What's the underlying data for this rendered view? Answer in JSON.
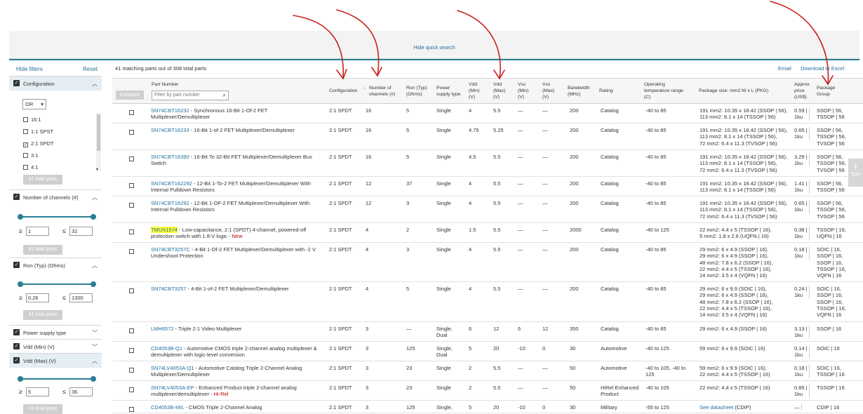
{
  "quick_search": {
    "hide_label": "Hide quick search"
  },
  "sidebar": {
    "hide_filters": "Hide filters",
    "reset": "Reset",
    "configuration": {
      "title": "Configuration",
      "operator": "OR",
      "options": [
        {
          "label": "16:1",
          "checked": false
        },
        {
          "label": "1:1 SPST",
          "checked": false
        },
        {
          "label": "2:1 SPDT",
          "checked": true
        },
        {
          "label": "3:1",
          "checked": false
        },
        {
          "label": "4:1",
          "checked": false
        }
      ],
      "parts_btn": "41 total parts"
    },
    "channels": {
      "title": "Number of channels (#)",
      "min": "1",
      "max": "32",
      "parts_btn": "41 total parts"
    },
    "ron": {
      "title": "Ron (Typ) (Ohms)",
      "min": "0.26",
      "max": "1300",
      "parts_btn": "41 total parts"
    },
    "power": {
      "title": "Power supply type"
    },
    "vdd_min": {
      "title": "Vdd (Min) (V)"
    },
    "vdd_max": {
      "title": "Vdd (Max) (V)",
      "min": "5",
      "max": "36",
      "parts_btn": "41 total parts"
    }
  },
  "results": {
    "summary": "41 matching parts out of 308 total parts",
    "email": "Email",
    "excel": "Download to Excel",
    "compare_btn": "Compare",
    "filter_placeholder": "Filter by part number",
    "headers": {
      "part_number": "Part Number",
      "configuration": "Configuration",
      "channels": "Number of channels (#)",
      "ron": "Ron (Typ) (Ohms)",
      "power": "Power supply type",
      "vdd_min": "Vdd (Min) (V)",
      "vdd_max": "Vdd (Max) (V)",
      "vss_min": "Vss (Min) (V)",
      "vss_max": "Vss (Max) (V)",
      "bandwidth": "Bandwidth (MHz)",
      "rating": "Rating",
      "temp": "Operating temperature range (C)",
      "pkg_size": "Package size: mm2:W x L (PKG)",
      "price": "Approx. price (US$)",
      "pkg_group": "Package Group"
    },
    "rows": [
      {
        "pn": "SN74CBT16232",
        "desc": " - Synchronous 16-Bit 1-Of-2 FET Multiplexer/Demultiplexer",
        "cfg": "2:1 SPDT",
        "ch": "16",
        "ron": "5",
        "ps": "Single",
        "vddmin": "4",
        "vddmax": "5.5",
        "vssmin": "—",
        "vssmax": "—",
        "bw": "200",
        "rating": "Catalog",
        "temp": "-40 to 85",
        "pkg": "191 mm2: 10.35 x 18.42 (SSOP | 56),\n113 mm2: 8.1 x 14 (TSSOP | 56)",
        "price": "0.59 |\n1ku",
        "grp": "SSOP | 56,\nTSSOP | 56"
      },
      {
        "pn": "SN74CBT16233",
        "desc": " - 16-Bit 1-of-2 FET Multiplexer/Demultiplexer",
        "cfg": "2:1 SPDT",
        "ch": "16",
        "ron": "5",
        "ps": "Single",
        "vddmin": "4.75",
        "vddmax": "5.25",
        "vssmin": "—",
        "vssmax": "—",
        "bw": "200",
        "rating": "Catalog",
        "temp": "-40 to 85",
        "pkg": "191 mm2: 10.35 x 18.42 (SSOP | 56),\n113 mm2: 8.1 x 14 (TSSOP | 56),\n72 mm2: 6.4 x 11.3 (TVSOP | 56)",
        "price": "0.65 |\n1ku",
        "grp": "SSOP | 56,\nTSSOP | 56,\nTVSOP | 56"
      },
      {
        "pn": "SN74CBT16390",
        "desc": " - 16-Bit To 32-Bit FET Multiplexer/Demultiplexer Bus Switch",
        "cfg": "2:1 SPDT",
        "ch": "16",
        "ron": "5",
        "ps": "Single",
        "vddmin": "4.5",
        "vddmax": "5.5",
        "vssmin": "—",
        "vssmax": "—",
        "bw": "200",
        "rating": "Catalog",
        "temp": "-40 to 85",
        "pkg": "191 mm2: 10.35 x 18.42 (SSOP | 56),\n113 mm2: 8.1 x 14 (TSSOP | 56),\n72 mm2: 6.4 x 11.3 (TVSOP | 56)",
        "price": "3.29 |\n1ku",
        "grp": "SSOP | 56,\nTSSOP | 56,\nTVSOP | 56"
      },
      {
        "pn": "SN74CBT162292",
        "desc": " - 12-Bit 1-To-2 FET Multiplexer/Demultiplexer With Internal Pulldown Resistors",
        "cfg": "2:1 SPDT",
        "ch": "12",
        "ron": "37",
        "ps": "Single",
        "vddmin": "4",
        "vddmax": "5.5",
        "vssmin": "—",
        "vssmax": "—",
        "bw": "200",
        "rating": "Catalog",
        "temp": "-40 to 85",
        "pkg": "191 mm2: 10.35 x 18.42 (SSOP | 56),\n113 mm2: 8.1 x 14 (TSSOP | 56)",
        "price": "1.41 |\n1ku",
        "grp": "SSOP | 56,\nTSSOP | 56"
      },
      {
        "pn": "SN74CBT16292",
        "desc": " - 12-Bit 1-OF-2 FET Multiplexer/Demultiplexer With Internal Pulldown Resistors",
        "cfg": "2:1 SPDT",
        "ch": "12",
        "ron": "3",
        "ps": "Single",
        "vddmin": "4",
        "vddmax": "5.5",
        "vssmin": "—",
        "vssmax": "—",
        "bw": "200",
        "rating": "Catalog",
        "temp": "-40 to 85",
        "pkg": "191 mm2: 10.35 x 18.42 (SSOP | 56),\n113 mm2: 8.1 x 14 (TSSOP | 56),\n72 mm2: 6.4 x 11.3 (TVSOP | 56)",
        "price": "0.65 |\n1ku",
        "grp": "SSOP | 56,\nTSSOP | 56,\nTVSOP | 56"
      },
      {
        "pn": "TMUX1574",
        "desc": " - Low-capacitance, 2:1 (SPDT) 4-channel, powered-off protection switch with 1.8-V logic",
        "tag": "New",
        "highlight": true,
        "cfg": "2:1 SPDT",
        "ch": "4",
        "ron": "2",
        "ps": "Single",
        "vddmin": "1.5",
        "vddmax": "5.5",
        "vssmin": "—",
        "vssmax": "—",
        "bw": "2000",
        "rating": "Catalog",
        "temp": "-40 to 125",
        "pkg": "22 mm2: 4.4 x 5 (TSSOP | 16),\n5 mm2: 1.8 x 2.6 (UQFN | 16)",
        "price": "0.38 |\n1ku",
        "grp": "TSSOP | 16,\nUQFN | 16"
      },
      {
        "pn": "SN74CBT3257C",
        "desc": " - 4-Bit 1-Of-2 FET Multiplexer/Demultiplexer with -2 V Undershoot Protection",
        "cfg": "2:1 SPDT",
        "ch": "4",
        "ron": "3",
        "ps": "Single",
        "vddmin": "4",
        "vddmax": "5.5",
        "vssmin": "—",
        "vssmax": "—",
        "bw": "200",
        "rating": "Catalog",
        "temp": "-40 to 85",
        "pkg": "29 mm2: 6 x 4.9 (SSOP | 16),\n29 mm2: 6 x 4.9 (SSOP | 16),\n48 mm2: 7.8 x 6.2 (SSOP | 16),\n22 mm2: 4.4 x 5 (TSSOP | 16),\n14 mm2: 3.5 x 4 (VQFN | 16)",
        "price": "0.18 |\n1ku",
        "grp": "SOIC | 16,\nSSOP | 16,\nSSOP | 16,\nTSSOP | 16,\nVQFN | 16"
      },
      {
        "pn": "SN74CBT3257",
        "desc": " - 4-Bit 1-of-2 FET Multiplexer/Demultiplexer",
        "cfg": "2:1 SPDT",
        "ch": "4",
        "ron": "5",
        "ps": "Single",
        "vddmin": "4",
        "vddmax": "5.5",
        "vssmin": "—",
        "vssmax": "—",
        "bw": "200",
        "rating": "Catalog",
        "temp": "-40 to 85",
        "pkg": "29 mm2: 6 x 9.9 (SOIC | 16),\n29 mm2: 6 x 4.9 (SSOP | 16),\n48 mm2: 7.8 x 6.2 (SSOP | 16),\n22 mm2: 4.4 x 5 (TSSOP | 16),\n14 mm2: 3.5 x 4 (VQFN | 16)",
        "price": "0.24 |\n1ku",
        "grp": "SOIC | 16,\nSSOP | 16,\nSSOP | 16,\nTSSOP | 16,\nVQFN | 16"
      },
      {
        "pn": "LMH6572",
        "desc": " - Triple 2:1 Video Multiplexer",
        "cfg": "2:1 SPDT",
        "ch": "3",
        "ron": "—",
        "ps": "Single,\nDual",
        "vddmin": "6",
        "vddmax": "12",
        "vssmin": "6",
        "vssmax": "12",
        "bw": "350",
        "rating": "Catalog",
        "temp": "-40 to 85",
        "pkg": "29 mm2: 6 x 4.9 (SSOP | 16)",
        "price": "3.13 |\n1ku",
        "grp": "SSOP | 16"
      },
      {
        "pn": "CD4053B-Q1",
        "desc": " - Automotive CMOS triple 2-channel analog multiplexer & demultiplexer with logic-level conversion",
        "cfg": "2:1 SPDT",
        "ch": "3",
        "ron": "125",
        "ps": "Single,\nDual",
        "vddmin": "5",
        "vddmax": "20",
        "vssmin": "-10",
        "vssmax": "0",
        "bw": "30",
        "rating": "Automotive",
        "temp": "-40 to 125",
        "pkg": "59 mm2: 6 x 9.9 (SOIC | 16)",
        "price": "0.14 |\n1ku",
        "grp": "SOIC | 16"
      },
      {
        "pn": "SN74LV4053A-Q1",
        "desc": " - Automotive Catalog Triple 2-Channel Analog Multiplexer/Demultiplexer",
        "cfg": "2:1 SPDT",
        "ch": "3",
        "ron": "23",
        "ps": "Single",
        "vddmin": "2",
        "vddmax": "5.5",
        "vssmin": "—",
        "vssmax": "—",
        "bw": "50",
        "rating": "Automotive",
        "temp": "-40 to 105, -40 to\n125",
        "pkg": "59 mm2: 6 x 9.9 (SOIC | 16),\n22 mm2: 4.4 x 5 (TSSOP | 16)",
        "price": "0.18 |\n1ku",
        "grp": "SOIC | 16,\nTSSOP | 16"
      },
      {
        "pn": "SN74LV4053A-EP",
        "desc": " - Enhanced Product triple 2-channel analog multiplexer/demultiplexer",
        "tag": "Hi-Rel",
        "cfg": "2:1 SPDT",
        "ch": "3",
        "ron": "23",
        "ps": "Single",
        "vddmin": "2",
        "vddmax": "5.5",
        "vssmin": "—",
        "vssmax": "—",
        "bw": "50",
        "rating": "HiRel Enhanced\nProduct",
        "temp": "-40 to 105",
        "pkg": "22 mm2: 4.4 x 5 (TSSOP | 16)",
        "price": "0.85 |\n1ku",
        "grp": "TSSOP | 16"
      },
      {
        "pn": "CD4053B-MIL",
        "desc": " - CMOS Triple 2-Channel Analog",
        "cfg": "2:1 SPDT",
        "ch": "3",
        "ron": "125",
        "ps": "Single,",
        "vddmin": "5",
        "vddmax": "20",
        "vssmin": "-10",
        "vssmax": "0",
        "bw": "30",
        "rating": "Military",
        "temp": "-55 to 125",
        "pkg_link": "See datasheet",
        "pkg": " (CDIP)",
        "price": "—",
        "grp": "CDIP | 16"
      }
    ]
  },
  "top_button": {
    "label": "TOP"
  },
  "colors": {
    "link": "#1f6fa0",
    "accent": "#2a7e93",
    "annotation": "#c8201c",
    "highlight": "#ffff33"
  }
}
